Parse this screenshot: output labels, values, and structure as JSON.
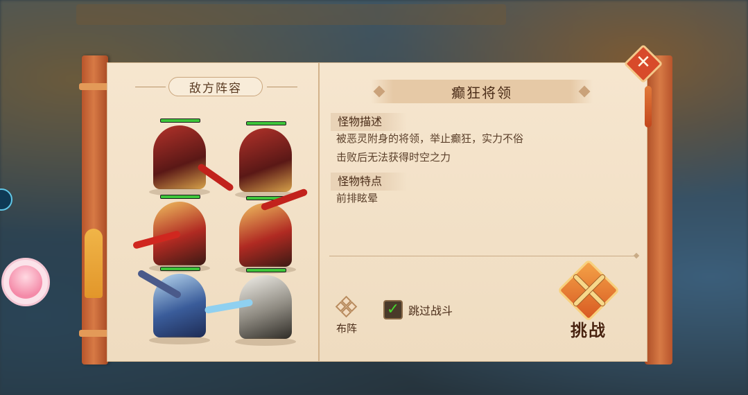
{
  "lineup": {
    "title": "敌方阵容",
    "heroes": [
      {
        "style": "red",
        "hp": 1.0
      },
      {
        "style": "red",
        "hp": 1.0
      },
      {
        "style": "gold",
        "hp": 1.0
      },
      {
        "style": "gold",
        "hp": 1.0
      },
      {
        "style": "blue",
        "hp": 1.0
      },
      {
        "style": "white",
        "hp": 1.0
      }
    ]
  },
  "boss": {
    "name": "癫狂将领",
    "description_heading": "怪物描述",
    "description_lines": [
      "被恶灵附身的将领，举止癫狂，实力不俗",
      "击败后无法获得时空之力"
    ],
    "traits_heading": "怪物特点",
    "traits": "前排眩晕"
  },
  "controls": {
    "formation_label": "布阵",
    "skip_battle_label": "跳过战斗",
    "skip_battle_checked": true,
    "challenge_label": "挑战",
    "close_glyph": "✕"
  },
  "colors": {
    "paper": "#f4e3c9",
    "scroll_rod": "#c9643a",
    "hp_bar": "#3ec63a",
    "accent": "#d85a22"
  }
}
